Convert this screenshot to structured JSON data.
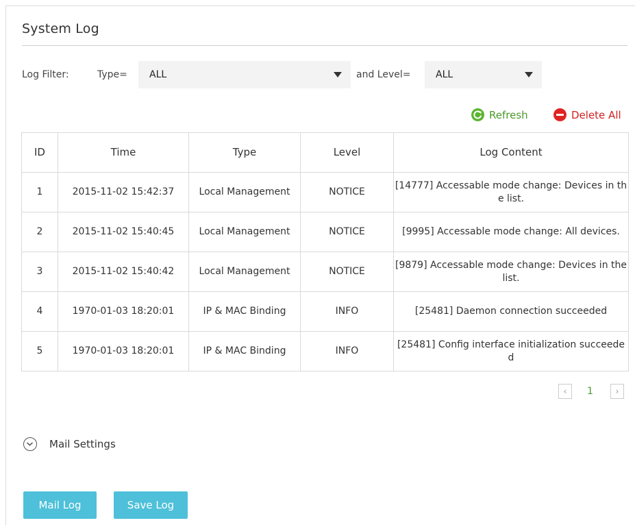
{
  "page": {
    "title": "System Log"
  },
  "filter": {
    "label": "Log Filter:",
    "type_label": "Type=",
    "type_value": "ALL",
    "level_label": "and Level=",
    "level_value": "ALL"
  },
  "actions": {
    "refresh": "Refresh",
    "delete_all": "Delete All"
  },
  "colors": {
    "refresh": "#5cb531",
    "delete": "#e02323",
    "button": "#4ec0d9"
  },
  "table": {
    "headers": {
      "id": "ID",
      "time": "Time",
      "type": "Type",
      "level": "Level",
      "content": "Log Content"
    },
    "rows": [
      {
        "id": "1",
        "time": "2015-11-02 15:42:37",
        "type": "Local Management",
        "level": "NOTICE",
        "content": "[14777] Accessable mode change: Devices in the list."
      },
      {
        "id": "2",
        "time": "2015-11-02 15:40:45",
        "type": "Local Management",
        "level": "NOTICE",
        "content": "[9995] Accessable mode change: All devices."
      },
      {
        "id": "3",
        "time": "2015-11-02 15:40:42",
        "type": "Local Management",
        "level": "NOTICE",
        "content": "[9879] Accessable mode change: Devices in the list."
      },
      {
        "id": "4",
        "time": "1970-01-03 18:20:01",
        "type": "IP & MAC Binding",
        "level": "INFO",
        "content": "[25481] Daemon connection succeeded"
      },
      {
        "id": "5",
        "time": "1970-01-03 18:20:01",
        "type": "IP & MAC Binding",
        "level": "INFO",
        "content": "[25481] Config interface initialization succeeded"
      }
    ]
  },
  "pagination": {
    "current_page": "1",
    "prev_icon": "chevron-left-icon",
    "next_icon": "chevron-right-icon"
  },
  "mail_settings": {
    "label": "Mail Settings",
    "icon": "chevron-down-circle-icon"
  },
  "buttons": {
    "mail_log": "Mail Log",
    "save_log": "Save Log"
  }
}
